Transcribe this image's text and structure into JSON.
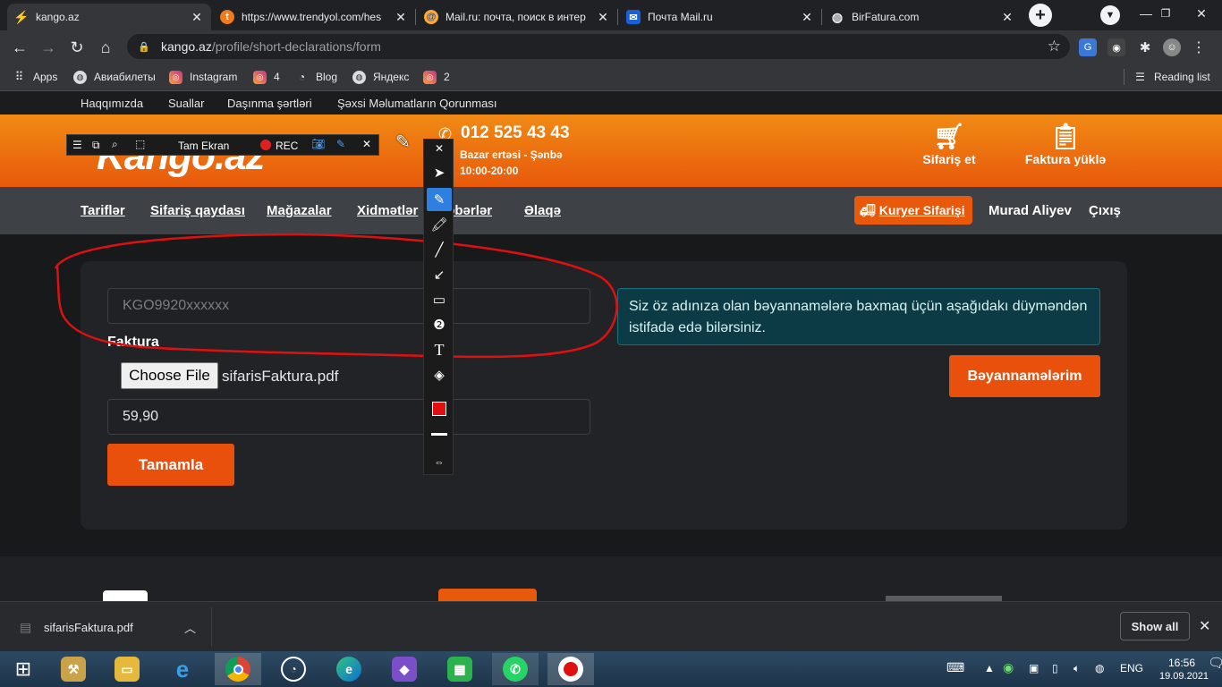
{
  "browser": {
    "tabs": [
      {
        "title": "kango.az",
        "icon": "kango-icon",
        "active": true
      },
      {
        "title": "https://www.trendyol.com/hes",
        "icon": "trendyol-icon",
        "active": false
      },
      {
        "title": "Mail.ru: почта, поиск в интер",
        "icon": "mailru-icon",
        "active": false
      },
      {
        "title": "Почта Mail.ru",
        "icon": "mail-envelope-icon",
        "active": false
      },
      {
        "title": "BirFatura.com",
        "icon": "globe-icon",
        "active": false
      }
    ],
    "url_domain": "kango.az",
    "url_path": "/profile/short-declarations/form",
    "bookmarks": [
      "Apps",
      "Авиабилеты",
      "Instagram",
      "4",
      "Blog",
      "Яндекс",
      "2"
    ],
    "reading_list": "Reading list"
  },
  "site": {
    "top_links": [
      "Haqqımızda",
      "Suallar",
      "Daşınma şərtləri",
      "Şəxsi Məlumatların Qorunması"
    ],
    "logo": "Kango.az",
    "phone": "012 525 43 43",
    "hours_days": "Bazar ertəsi - Şənbə",
    "hours_time": "10:00-20:00",
    "header_actions": [
      "Sifariş et",
      "Faktura yüklə"
    ],
    "nav": [
      "Tariflər",
      "Sifariş qaydası",
      "Mağazalar",
      "Xidmətlər",
      "Xəbərlər",
      "Əlaqə"
    ],
    "courier_button": "Kuryer Sifarişi",
    "user_name": "Murad Aliyev",
    "logout": "Çıxış",
    "form": {
      "tracking_placeholder": "KGO9920xxxxxx",
      "invoice_label": "Faktura",
      "choose_file": "Choose File",
      "file_name": "sifarisFaktura.pdf",
      "price_value": "59,90",
      "submit": "Tamamla"
    },
    "info_text": "Siz öz adınıza olan bəyannamələrə baxmaq üçün aşağıdakı düyməndən istifadə edə bilərsiniz.",
    "declarations_button": "Bəyannamələrim"
  },
  "recorder": {
    "fullscreen_label": "Tam Ekran",
    "rec_label": "REC"
  },
  "downloads": {
    "file": "sifarisFaktura.pdf",
    "show_all": "Show all"
  },
  "taskbar": {
    "lang": "ENG",
    "time": "16:56",
    "date": "19.09.2021"
  },
  "colors": {
    "brand_orange": "#e8590c",
    "annotation_red": "#e01010"
  }
}
